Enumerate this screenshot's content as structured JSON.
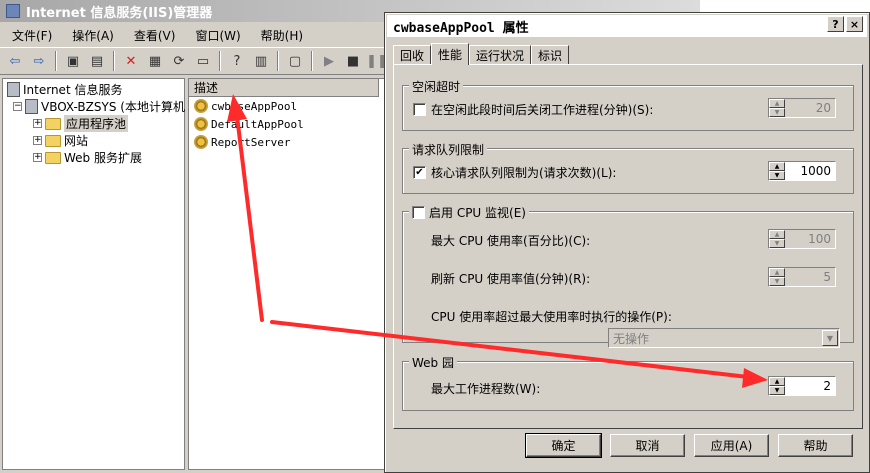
{
  "iis": {
    "title": "Internet 信息服务(IIS)管理器",
    "menu": [
      "文件(F)",
      "操作(A)",
      "查看(V)",
      "窗口(W)",
      "帮助(H)"
    ],
    "tree": {
      "root": "Internet 信息服务",
      "server": "VBOX-BZSYS (本地计算机",
      "children": [
        "应用程序池",
        "网站",
        "Web 服务扩展"
      ]
    },
    "list": {
      "header": "描述",
      "items": [
        "cwbaseAppPool",
        "DefaultAppPool",
        "ReportServer"
      ]
    }
  },
  "dialog": {
    "title": "cwbaseAppPool 属性",
    "help_glyph": "?",
    "close_glyph": "×",
    "tabs": [
      "回收",
      "性能",
      "运行状况",
      "标识"
    ],
    "active_tab": "性能",
    "idle": {
      "legend": "空闲超时",
      "checkbox_label": "在空闲此段时间后关闭工作进程(分钟)(S):",
      "checked": false,
      "value": "20"
    },
    "queue": {
      "legend": "请求队列限制",
      "checkbox_label": "核心请求队列限制为(请求次数)(L):",
      "checked": true,
      "value": "1000"
    },
    "cpu": {
      "legend": "启用 CPU 监视(E)",
      "checked": false,
      "max_label": "最大 CPU 使用率(百分比)(C):",
      "max_value": "100",
      "refresh_label": "刷新 CPU 使用率值(分钟)(R):",
      "refresh_value": "5",
      "action_label": "CPU 使用率超过最大使用率时执行的操作(P):",
      "action_value": "无操作"
    },
    "garden": {
      "legend": "Web 园",
      "max_label": "最大工作进程数(W):",
      "value": "2"
    },
    "buttons": [
      "确定",
      "取消",
      "应用(A)",
      "帮助"
    ]
  },
  "colors": {
    "face": "#d4d0c8",
    "annotation_arrow": "#ff2a2a"
  }
}
